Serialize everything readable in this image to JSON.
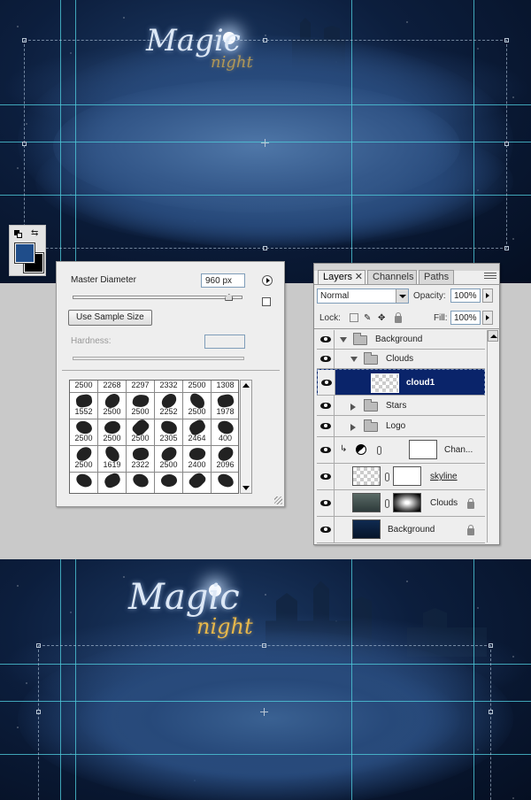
{
  "canvas_top": {
    "logo_main": "Magic",
    "logo_sub": "night"
  },
  "canvas_bottom": {
    "logo_main": "Magic",
    "logo_sub": "night"
  },
  "color_tool": {
    "foreground": "#1f4d8a",
    "background": "#000000",
    "swap_icon": "⇆"
  },
  "brush_panel": {
    "master_diameter_label": "Master Diameter",
    "master_diameter_value": "960 px",
    "master_diameter_level": 0.96,
    "use_sample_size_label": "Use Sample Size",
    "hardness_label": "Hardness:",
    "hardness_value": "",
    "rows": [
      [
        "2500",
        "2268",
        "2297",
        "2332",
        "2500",
        "1308"
      ],
      [
        "1552",
        "2500",
        "2500",
        "2252",
        "2500",
        "1978"
      ],
      [
        "2500",
        "2500",
        "2500",
        "2305",
        "2464",
        "400"
      ],
      [
        "2500",
        "1619",
        "2322",
        "2500",
        "2400",
        "2096"
      ],
      [
        "",
        "",
        "",
        "",
        "",
        ""
      ]
    ]
  },
  "layers_panel": {
    "tabs": [
      {
        "label": "Layers",
        "active": true
      },
      {
        "label": "Channels",
        "active": false
      },
      {
        "label": "Paths",
        "active": false
      }
    ],
    "close_icon": "✕",
    "blend_mode": "Normal",
    "opacity_label": "Opacity:",
    "opacity_value": "100%",
    "lock_label": "Lock:",
    "fill_label": "Fill:",
    "fill_value": "100%",
    "layers": [
      {
        "name": "Background",
        "type": "group",
        "expanded": true,
        "indent": 0
      },
      {
        "name": "Clouds",
        "type": "group",
        "expanded": true,
        "indent": 1
      },
      {
        "name": "cloud1",
        "type": "layer",
        "selected": true,
        "indent": 2
      },
      {
        "name": "Stars",
        "type": "group",
        "expanded": false,
        "indent": 1
      },
      {
        "name": "Logo",
        "type": "group",
        "expanded": false,
        "indent": 1
      },
      {
        "name": "Chan...",
        "type": "adjustment",
        "indent": 1
      },
      {
        "name": "skyline",
        "type": "masked",
        "indent": 1
      },
      {
        "name": "Clouds",
        "type": "masked-locked",
        "indent": 1
      },
      {
        "name": "Background",
        "type": "locked",
        "indent": 1
      }
    ]
  }
}
